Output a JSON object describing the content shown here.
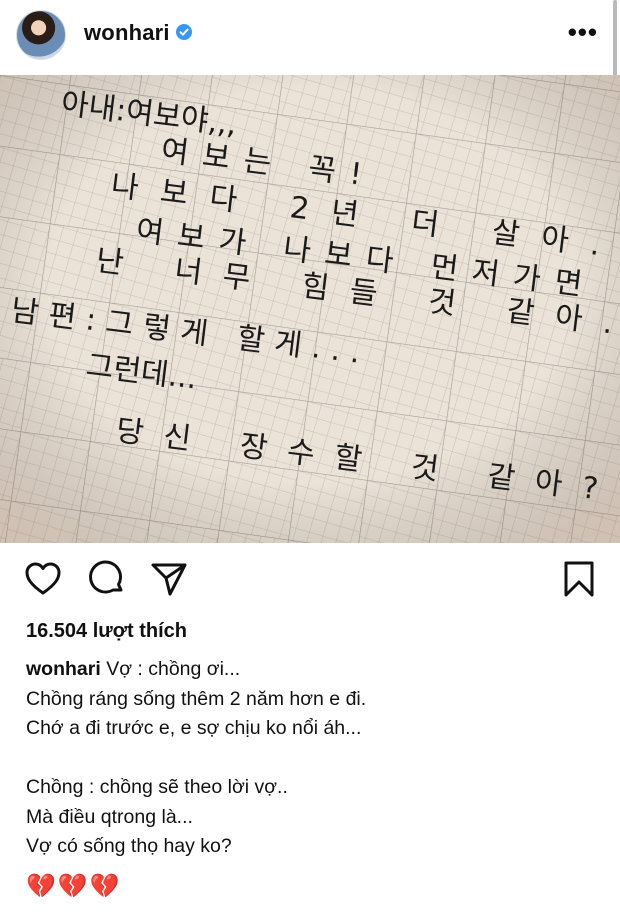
{
  "post": {
    "username": "wonhari",
    "verified_icon": "verified-badge-icon",
    "more_icon": "more-options-icon",
    "more_glyph": "•••",
    "image": {
      "description_text_lines": [
        "아내:여보야,,,",
        "여보는 꼭!",
        "나보다 2년 더 살아.",
        "여보가 나보다 먼저가면",
        "난 너무 힘들 것 같아...",
        "남편:그렇게 할게...",
        "그런데...",
        "당신 장수할 것 같아?"
      ]
    },
    "likes_text": "16.504 lượt thích",
    "caption": {
      "first_line": "Vợ : chồng ơi...",
      "lines": [
        "Chồng ráng sống thêm 2 năm hơn e đi.",
        "Chớ a đi trước e, e sợ chịu ko nổi áh...",
        "",
        "Chồng : chồng sẽ theo lời vợ..",
        "Mà điều qtrong là...",
        "Vợ có sống thọ hay ko?"
      ],
      "emoji": "💔💔💔"
    }
  },
  "colors": {
    "paper": "#ece3d8",
    "grid": "#b9b3ad",
    "ink": "#1a1a1a"
  }
}
